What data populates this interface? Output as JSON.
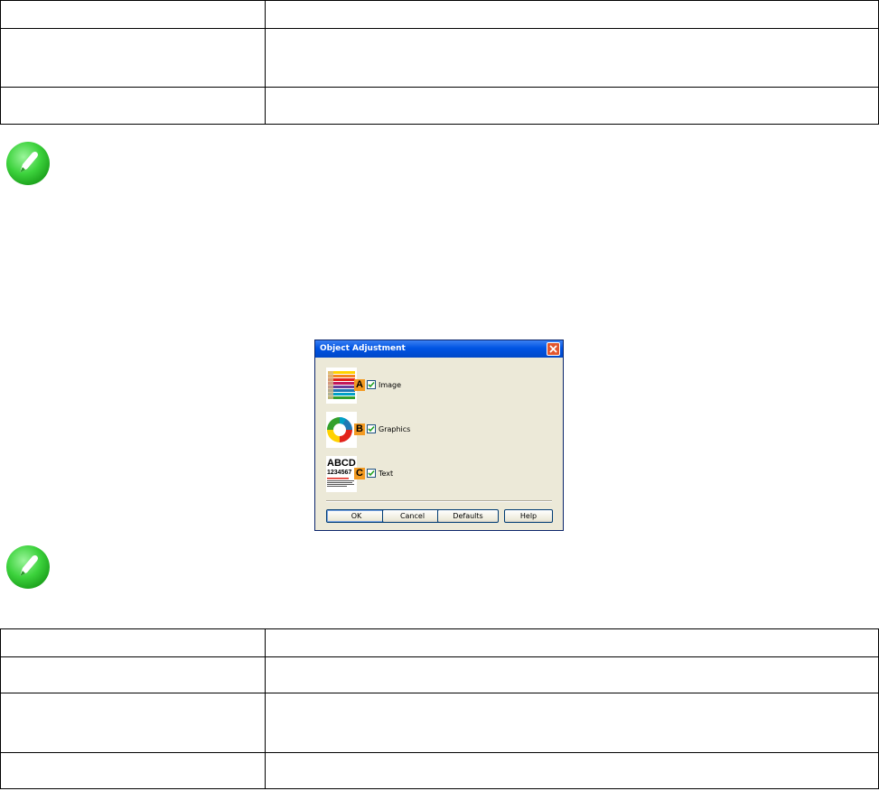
{
  "dialog": {
    "title": "Object Adjustment",
    "rows": [
      {
        "letter": "A",
        "label": "Image",
        "checked": true
      },
      {
        "letter": "B",
        "label": "Graphics",
        "checked": true
      },
      {
        "letter": "C",
        "label": "Text",
        "checked": true
      }
    ],
    "text_thumb": {
      "line1": "ABCD",
      "line2": "1234567"
    },
    "buttons": {
      "ok": "OK",
      "cancel": "Cancel",
      "defaults": "Defaults",
      "help": "Help"
    }
  },
  "colors": {
    "titlebar": "#0054e3",
    "badge": "#f39a21",
    "note_icon": "#3cd23c"
  },
  "icons": [
    "note-pencil-icon",
    "close-icon",
    "checkbox-checked-icon"
  ]
}
